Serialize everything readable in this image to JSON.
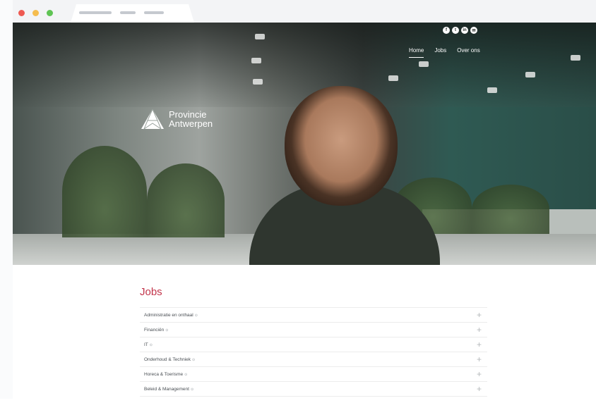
{
  "browser": {
    "window_dots": [
      "#ee5a52",
      "#f5bd4f",
      "#5fc454"
    ],
    "tab_bars": [
      46,
      22,
      28
    ]
  },
  "header": {
    "social_icons": [
      {
        "name": "facebook-icon",
        "glyph": "f"
      },
      {
        "name": "twitter-icon",
        "glyph": "t"
      },
      {
        "name": "linkedin-icon",
        "glyph": "in"
      },
      {
        "name": "mail-icon",
        "glyph": "✉"
      }
    ],
    "nav": [
      "Home",
      "Jobs",
      "Over ons"
    ],
    "active_nav": "Home",
    "logo_line1": "Provincie",
    "logo_line2": "Antwerpen"
  },
  "jobs": {
    "title": "Jobs",
    "accent_color": "#c2344a",
    "items": [
      "Administratie en onthaal",
      "Financiën",
      "IT",
      "Onderhoud & Techniek",
      "Horeca & Toerisme",
      "Beleid & Management"
    ]
  }
}
